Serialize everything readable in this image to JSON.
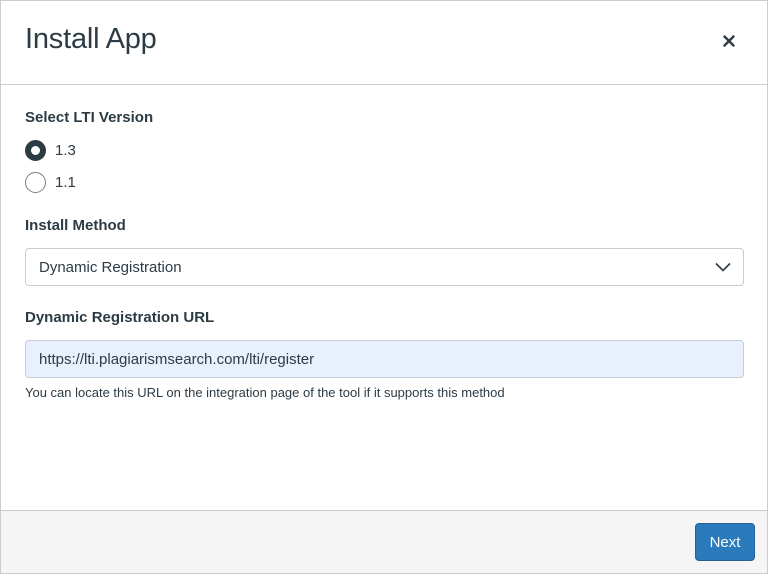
{
  "dialog": {
    "title": "Install App",
    "close_icon": "close-icon"
  },
  "lti_version": {
    "label": "Select LTI Version",
    "options": [
      {
        "label": "1.3",
        "checked": true
      },
      {
        "label": "1.1",
        "checked": false
      }
    ]
  },
  "install_method": {
    "label": "Install Method",
    "selected": "Dynamic Registration",
    "icon": "chevron-down-icon"
  },
  "registration_url": {
    "label": "Dynamic Registration URL",
    "value": "https://lti.plagiarismsearch.com/lti/register",
    "hint": "You can locate this URL on the integration page of the tool if it supports this method"
  },
  "footer": {
    "next_label": "Next"
  },
  "colors": {
    "primary_button": "#2b7abc",
    "text": "#2d3b45",
    "border": "#c7cdd1",
    "footer_bg": "#f5f5f5",
    "autofill_bg": "#e8f0fe"
  }
}
